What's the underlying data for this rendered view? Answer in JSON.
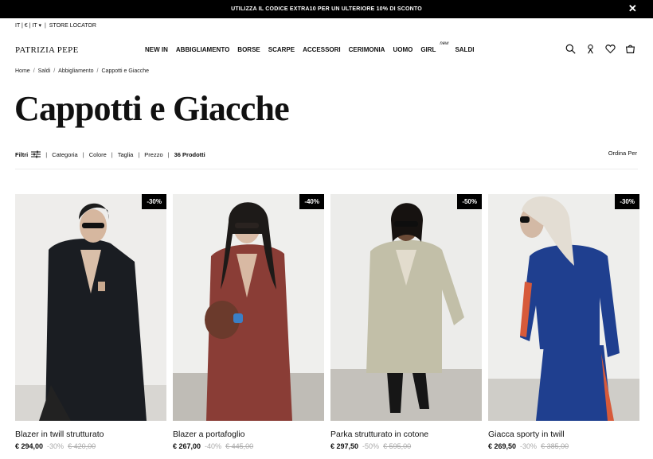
{
  "promo": {
    "text": "UTILIZZA IL CODICE EXTRA10 PER UN ULTERIORE 10% DI SCONTO",
    "close": "✕"
  },
  "util": {
    "locale": "IT | € | IT ▾",
    "store_locator": "STORE LOCATOR"
  },
  "logo": "PATRIZIA PEPE",
  "nav": [
    {
      "label": "NEW IN"
    },
    {
      "label": "ABBIGLIAMENTO"
    },
    {
      "label": "BORSE"
    },
    {
      "label": "SCARPE"
    },
    {
      "label": "ACCESSORI"
    },
    {
      "label": "CERIMONIA"
    },
    {
      "label": "UOMO"
    },
    {
      "label": "GIRL",
      "tag": "new"
    },
    {
      "label": "SALDI"
    }
  ],
  "breadcrumb": [
    "Home",
    "Saldi",
    "Abbigliamento",
    "Cappotti e Giacche"
  ],
  "page_title": "Cappotti e Giacche",
  "filters": {
    "label": "Filtri",
    "items": [
      "Categoria",
      "Colore",
      "Taglia",
      "Prezzo"
    ],
    "count": "36 Prodotti",
    "sort": "Ordina Per"
  },
  "products": [
    {
      "name": "Blazer in twill strutturato",
      "price": "€ 294,00",
      "discount": "-30%",
      "old_price": "€ 420,00",
      "badge": "-30%",
      "color": "#1a1d22"
    },
    {
      "name": "Blazer a portafoglio",
      "price": "€ 267,00",
      "discount": "-40%",
      "old_price": "€ 445,00",
      "badge": "-40%",
      "color": "#8a3d36"
    },
    {
      "name": "Parka strutturato in cotone",
      "price": "€ 297,50",
      "discount": "-50%",
      "old_price": "€ 595,00",
      "badge": "-50%",
      "color": "#c2bfa8"
    },
    {
      "name": "Giacca sporty in twill",
      "price": "€ 269,50",
      "discount": "-30%",
      "old_price": "€ 385,00",
      "badge": "-30%",
      "color": "#1f3f8f"
    }
  ]
}
